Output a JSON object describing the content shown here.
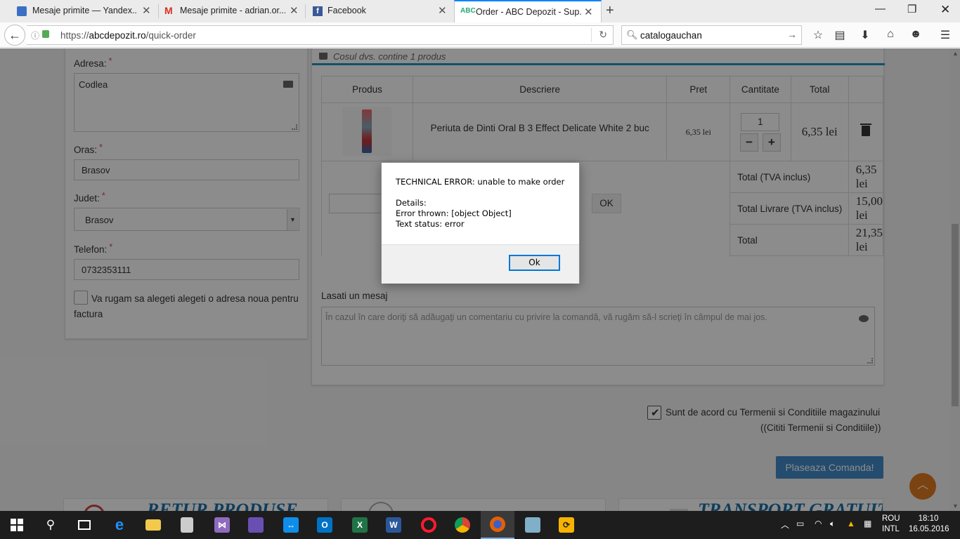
{
  "browser": {
    "tabs": [
      {
        "title": "Mesaje primite — Yandex....",
        "active": false
      },
      {
        "title": "Mesaje primite - adrian.or....",
        "active": false
      },
      {
        "title": "Facebook",
        "active": false
      },
      {
        "title": "Order - ABC Depozit - Sup...",
        "active": true
      }
    ],
    "url_prefix": "https://",
    "url_host": "abcdepozit.ro",
    "url_path": "/quick-order",
    "search_value": "catalogauchan"
  },
  "address_form": {
    "adresa_label": "Adresa:",
    "adresa_value": "Codlea",
    "oras_label": "Oras:",
    "oras_value": "Brasov",
    "judet_label": "Judet:",
    "judet_value": "Brasov",
    "telefon_label": "Telefon:",
    "telefon_value": "0732353111",
    "required_mark": "*",
    "billing_checkbox_label": "Va rugam sa alegeti alegeti o adresa noua pentru factura"
  },
  "cart": {
    "header": "Cosul dvs. contine 1 produs",
    "columns": [
      "Produs",
      "Descriere",
      "Pret",
      "Cantitate",
      "Total"
    ],
    "item": {
      "description": "Periuta de Dinti Oral B 3 Effect Delicate White 2 buc",
      "price": "6,35 lei",
      "quantity": "1",
      "total": "6,35 lei"
    },
    "coupon_button": "OK",
    "summary": [
      {
        "label": "Total (TVA inclus)",
        "value": "6,35 lei"
      },
      {
        "label": "Total Livrare (TVA inclus)",
        "value": "15,00 lei"
      },
      {
        "label": "Total",
        "value": "21,35 lei"
      }
    ],
    "message_label": "Lasati un mesaj",
    "message_placeholder": "În cazul în care doriţi să adăugaţi un comentariu cu privire la comandă, vă rugăm să-l scrieţi în câmpul de mai jos."
  },
  "terms": {
    "line1": "Sunt de acord cu Termenii si Conditiile magazinului",
    "line2": "((Cititi Termenii si Conditiile))",
    "checked": true
  },
  "order_button": "Plaseaza Comanda!",
  "footer_banners": [
    "RETUR PRODUSE",
    "TRANSPORT GRATUIT"
  ],
  "dialog": {
    "line1": "TECHNICAL ERROR: unable to make order",
    "line2": "Details:",
    "line3": "Error thrown: [object Object]",
    "line4": "Text status: error",
    "ok_label": "Ok"
  },
  "taskbar": {
    "lang_line1": "ROU",
    "lang_line2": "INTL",
    "time": "18:10",
    "date": "16.05.2016"
  },
  "colors": {
    "accent_blue": "#428bca",
    "cart_line": "#1a98c2",
    "to_top_orange": "#e07b1f",
    "required_red": "#d9534f"
  }
}
